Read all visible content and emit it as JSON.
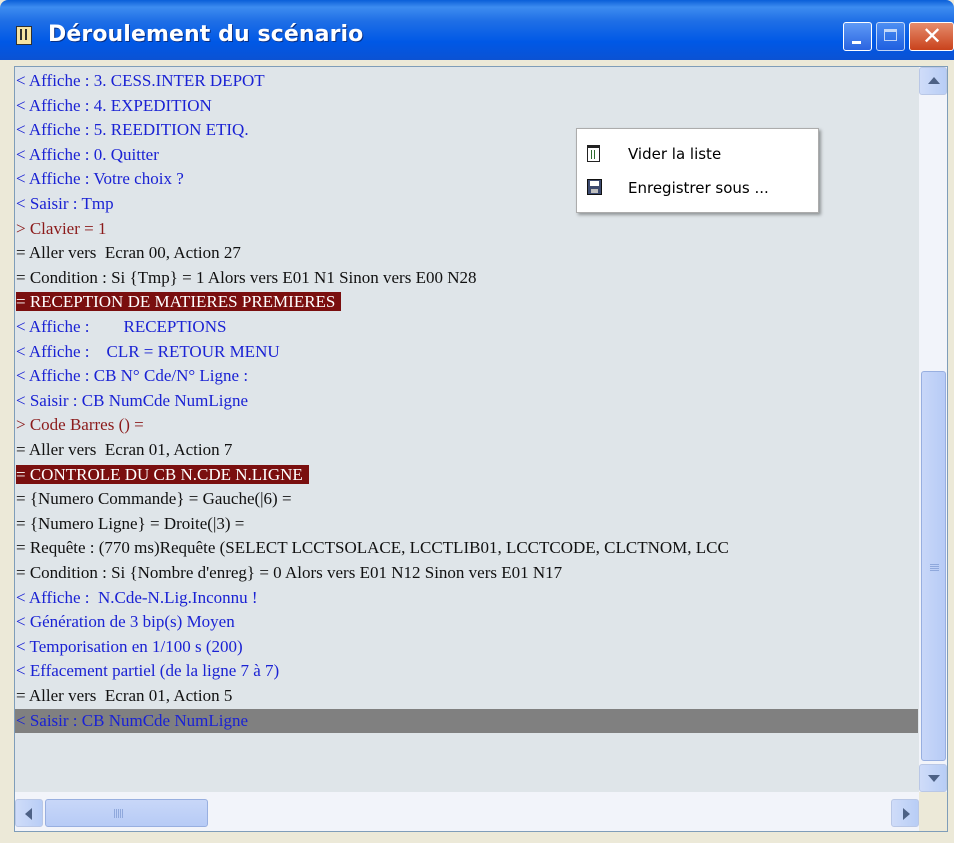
{
  "window": {
    "title": "Déroulement du scénario",
    "icon": "notepad-icon"
  },
  "titlebar_buttons": [
    "minimize-icon",
    "maximize-icon",
    "close-icon"
  ],
  "log_lines": [
    {
      "text": "< Affiche : 3. CESS.INTER DEPOT",
      "kind": "display"
    },
    {
      "text": "< Affiche : 4. EXPEDITION",
      "kind": "display"
    },
    {
      "text": "< Affiche : 5. REEDITION ETIQ.",
      "kind": "display"
    },
    {
      "text": "< Affiche : 0. Quitter",
      "kind": "display"
    },
    {
      "text": "< Affiche : Votre choix ?",
      "kind": "display"
    },
    {
      "text": "< Saisir : Tmp",
      "kind": "display"
    },
    {
      "text": "> Clavier = 1",
      "kind": "input"
    },
    {
      "text": "= Aller vers  Ecran 00, Action 27",
      "kind": "action"
    },
    {
      "text": "= Condition : Si {Tmp} = 1 Alors vers E01 N1 Sinon vers E00 N28",
      "kind": "action"
    },
    {
      "text": "= RECEPTION DE MATIERES PREMIERES",
      "kind": "section"
    },
    {
      "text": "< Affiche :        RECEPTIONS",
      "kind": "display"
    },
    {
      "text": "< Affiche :    CLR = RETOUR MENU",
      "kind": "display"
    },
    {
      "text": "< Affiche : CB N° Cde/N° Ligne :",
      "kind": "display"
    },
    {
      "text": "< Saisir : CB NumCde NumLigne",
      "kind": "display"
    },
    {
      "text": "> Code Barres () =",
      "kind": "input"
    },
    {
      "text": "= Aller vers  Ecran 01, Action 7",
      "kind": "action"
    },
    {
      "text": "= CONTROLE DU CB N.CDE N.LIGNE",
      "kind": "section"
    },
    {
      "text": "= {Numero Commande} = Gauche(|6) =",
      "kind": "action"
    },
    {
      "text": "= {Numero Ligne} = Droite(|3) =",
      "kind": "action"
    },
    {
      "text": "= Requête : (770 ms)Requête (SELECT LCCTSOLACE, LCCTLIB01, LCCTCODE, CLCTNOM, LCC",
      "kind": "action"
    },
    {
      "text": "= Condition : Si {Nombre d'enreg} = 0 Alors vers E01 N12 Sinon vers E01 N17",
      "kind": "action"
    },
    {
      "text": "< Affiche :  N.Cde-N.Lig.Inconnu !",
      "kind": "display"
    },
    {
      "text": "< Génération de 3 bip(s) Moyen",
      "kind": "display"
    },
    {
      "text": "< Temporisation en 1/100 s (200)",
      "kind": "display"
    },
    {
      "text": "< Effacement partiel (de la ligne 7 à 7)",
      "kind": "display"
    },
    {
      "text": "= Aller vers  Ecran 01, Action 5",
      "kind": "action"
    },
    {
      "text": "< Saisir : CB NumCde NumLigne",
      "kind": "selected"
    }
  ],
  "colors": {
    "display": "#1a22d4",
    "input": "#8b1a1a",
    "action": "#111111",
    "section_bg": "#7a0f0f",
    "selected_bg": "#808080",
    "list_bg": "#dfe5e9"
  },
  "context_menu": {
    "items": [
      {
        "label": "Vider la liste",
        "icon": "trash-bin-icon"
      },
      {
        "label": "Enregistrer sous ...",
        "icon": "floppy-disk-icon"
      }
    ]
  }
}
